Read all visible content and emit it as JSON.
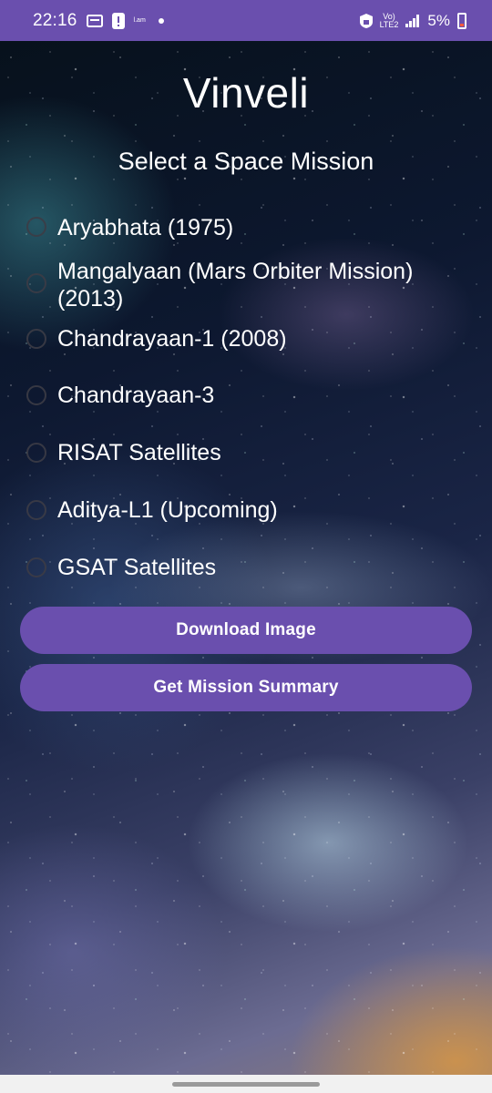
{
  "status_bar": {
    "time": "22:16",
    "tiny_label": "l.am",
    "network_top": "Vo)",
    "network_bottom": "LTE2",
    "battery_text": "5%"
  },
  "app": {
    "title": "Vinveli",
    "subtitle": "Select a Space Mission",
    "missions": [
      {
        "label": "Aryabhata (1975)",
        "selected": false
      },
      {
        "label": "Mangalyaan (Mars Orbiter Mission) (2013)",
        "selected": false
      },
      {
        "label": "Chandrayaan-1 (2008)",
        "selected": false
      },
      {
        "label": "Chandrayaan-3",
        "selected": false
      },
      {
        "label": "RISAT Satellites",
        "selected": false
      },
      {
        "label": "Aditya-L1 (Upcoming)",
        "selected": false
      },
      {
        "label": "GSAT Satellites",
        "selected": false
      }
    ],
    "buttons": {
      "download": "Download Image",
      "summary": "Get Mission Summary"
    }
  },
  "colors": {
    "accent": "#6a4fae",
    "text": "#ffffff"
  }
}
